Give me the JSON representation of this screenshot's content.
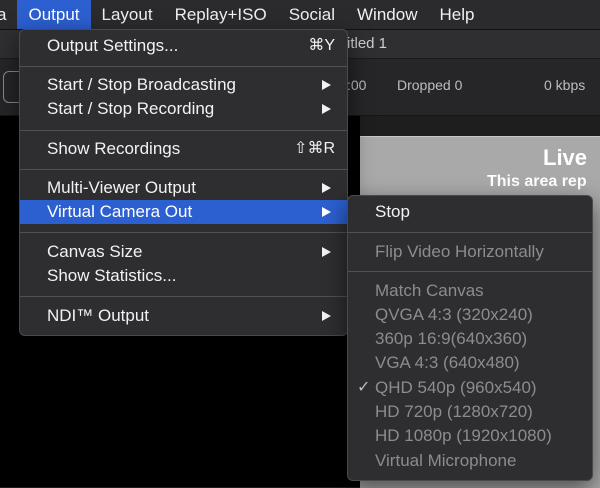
{
  "menubar": {
    "items": [
      {
        "label": "a"
      },
      {
        "label": "Output"
      },
      {
        "label": "Layout"
      },
      {
        "label": "Replay+ISO"
      },
      {
        "label": "Social"
      },
      {
        "label": "Window"
      },
      {
        "label": "Help"
      }
    ]
  },
  "window": {
    "title": "itled 1"
  },
  "toolbar": {
    "time_fragment": ":00",
    "dropped": "Dropped 0",
    "bitrate": "0 kbps"
  },
  "preview": {
    "live_label": "Live",
    "area_text": "This area rep"
  },
  "output_menu": {
    "output_settings": {
      "label": "Output Settings...",
      "shortcut": "⌘Y"
    },
    "start_stop_broadcasting": {
      "label": "Start / Stop Broadcasting"
    },
    "start_stop_recording": {
      "label": "Start / Stop Recording"
    },
    "show_recordings": {
      "label": "Show Recordings",
      "shortcut": "⇧⌘R"
    },
    "multi_viewer_output": {
      "label": "Multi-Viewer Output"
    },
    "virtual_camera_out": {
      "label": "Virtual Camera Out"
    },
    "canvas_size": {
      "label": "Canvas Size"
    },
    "show_statistics": {
      "label": "Show Statistics..."
    },
    "ndi_output": {
      "label": "NDI™ Output"
    }
  },
  "virtual_camera_submenu": {
    "stop": {
      "label": "Stop"
    },
    "flip_video": {
      "label": "Flip Video Horizontally"
    },
    "match_canvas": {
      "label": "Match Canvas"
    },
    "qvga": {
      "label": "QVGA 4:3 (320x240)"
    },
    "p360": {
      "label": "360p 16:9(640x360)"
    },
    "vga": {
      "label": "VGA 4:3 (640x480)"
    },
    "qhd": {
      "label": "QHD 540p (960x540)",
      "checkmark": "✓"
    },
    "hd720": {
      "label": "HD 720p (1280x720)"
    },
    "hd1080": {
      "label": "HD 1080p (1920x1080)"
    },
    "virtual_microphone": {
      "label": "Virtual Microphone"
    }
  },
  "colors": {
    "highlight": "#2c5fd0",
    "menu_bg": "#2e2e30",
    "disabled_text": "#8c8c8c"
  }
}
